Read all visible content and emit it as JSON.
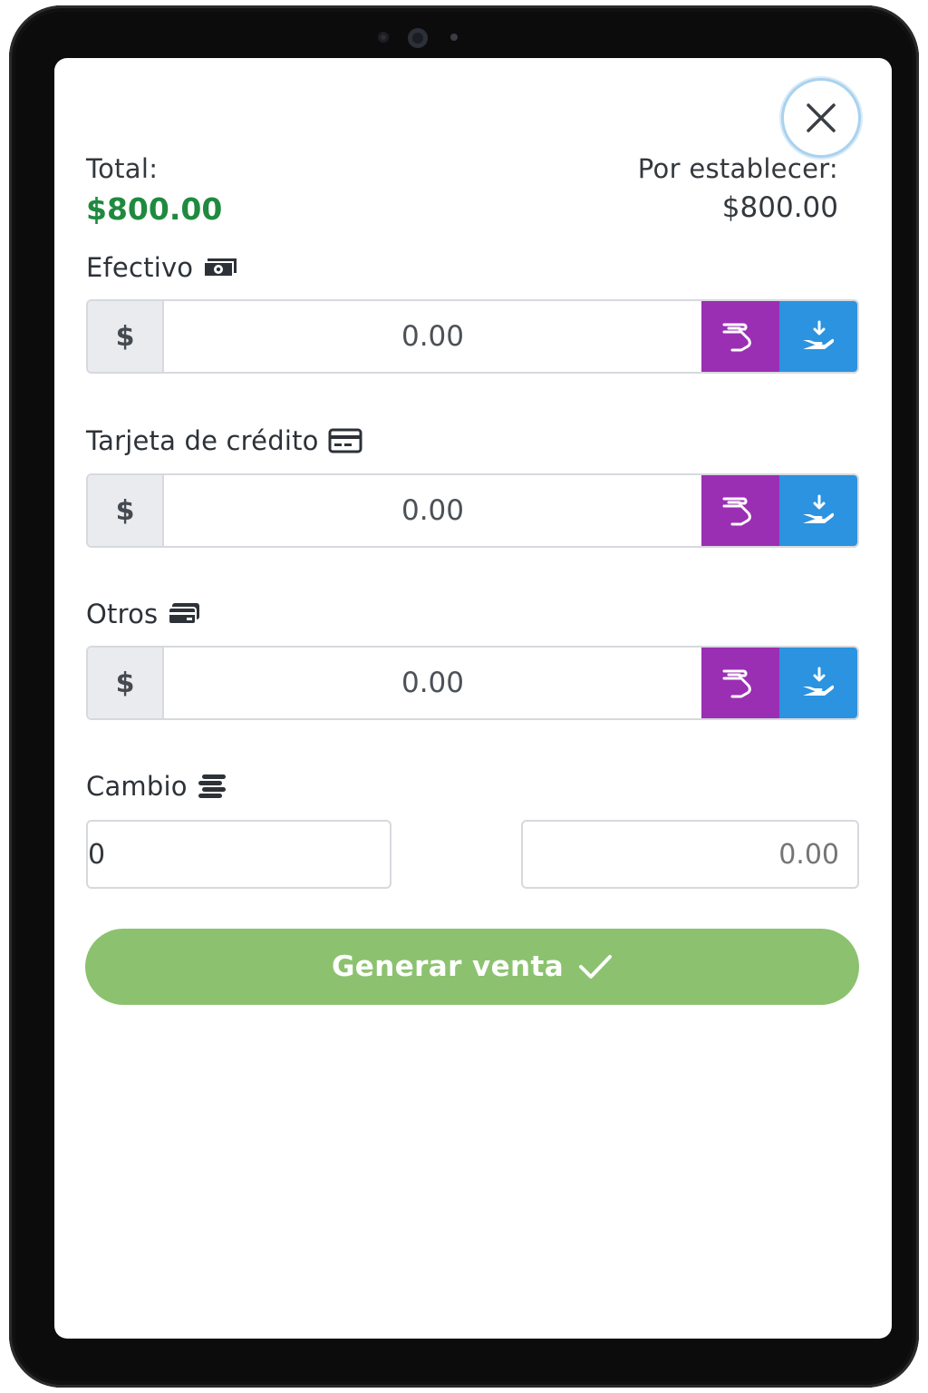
{
  "header": {
    "total_label": "Total:",
    "total_amount": "$800.00",
    "pending_label": "Por establecer:",
    "pending_amount": "$800.00"
  },
  "payments": [
    {
      "label": "Efectivo",
      "icon": "banknote-icon",
      "prefix": "$",
      "value": "0.00"
    },
    {
      "label": "Tarjeta de crédito",
      "icon": "credit-card-icon",
      "prefix": "$",
      "value": "0.00"
    },
    {
      "label": "Otros",
      "icon": "cards-icon",
      "prefix": "$",
      "value": "0.00"
    }
  ],
  "change": {
    "label": "Cambio",
    "icon": "coins-icon",
    "left_value": "0",
    "right_placeholder": "0.00"
  },
  "actions": {
    "generate_label": "Generar venta",
    "close": "close-icon",
    "fill_icon": "hand-card-icon",
    "receive_icon": "receive-hand-icon"
  },
  "colors": {
    "total_green": "#1f8a3f",
    "purple": "#9a2fb3",
    "blue": "#2b93e0",
    "generate_green": "#8cc26f"
  }
}
